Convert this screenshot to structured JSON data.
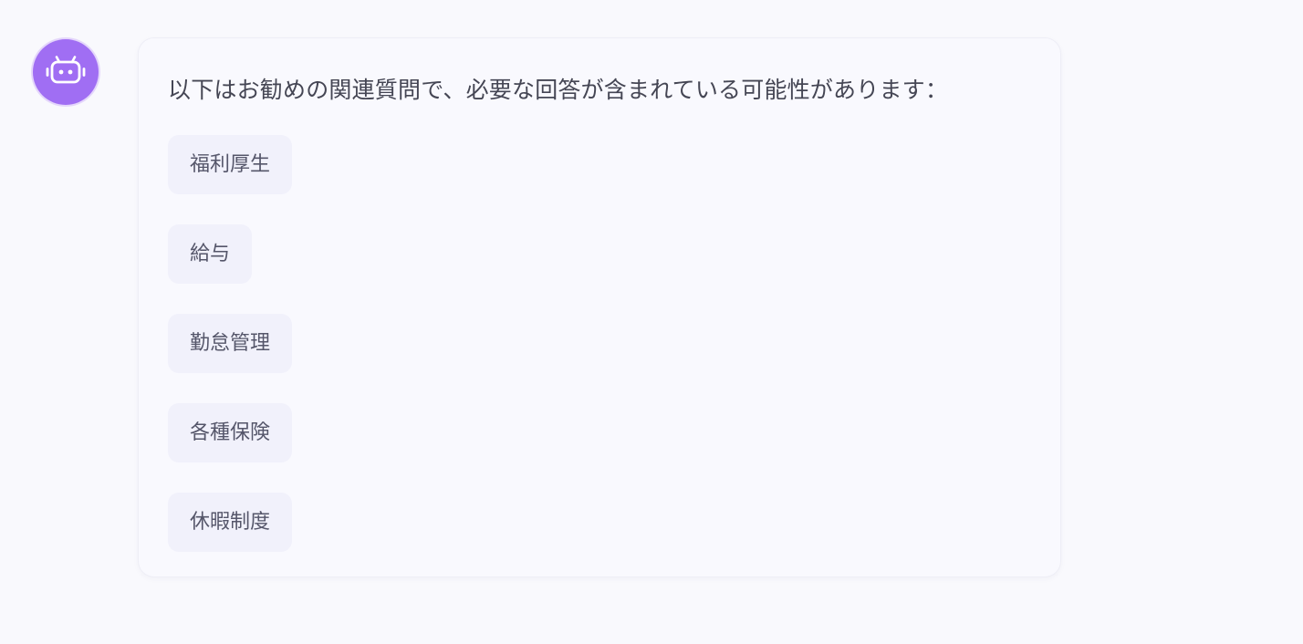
{
  "assistant": {
    "avatar_icon": "robot-icon",
    "avatar_color": "#a06ef3"
  },
  "message": {
    "intro": "以下はお勧めの関連質問で、必要な回答が含まれている可能性があります：",
    "suggestions": [
      {
        "label": "福利厚生"
      },
      {
        "label": "給与"
      },
      {
        "label": "勤怠管理"
      },
      {
        "label": "各種保険"
      },
      {
        "label": "休暇制度"
      }
    ]
  }
}
